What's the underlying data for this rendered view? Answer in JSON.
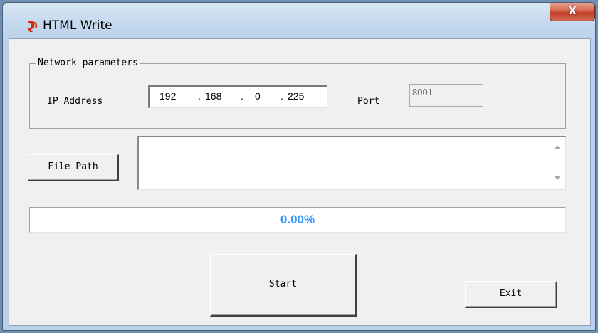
{
  "window": {
    "title": "HTML Write",
    "close_label": "X"
  },
  "network": {
    "group_title": "Network parameters",
    "ip_label": "IP Address",
    "ip_octets": [
      "192",
      "168",
      "0",
      "225"
    ],
    "port_label": "Port",
    "port_value": "8001"
  },
  "file": {
    "button_label": "File Path",
    "path_value": ""
  },
  "progress": {
    "value": 0.0,
    "text": "0.00%"
  },
  "buttons": {
    "start_label": "Start",
    "exit_label": "Exit"
  },
  "colors": {
    "progress_text": "#3399ff",
    "icon": "#d62a10"
  },
  "icons": {
    "app": "app-logo-icon",
    "close": "close-icon",
    "scroll_up": "scroll-up-arrow-icon",
    "scroll_down": "scroll-down-arrow-icon"
  }
}
